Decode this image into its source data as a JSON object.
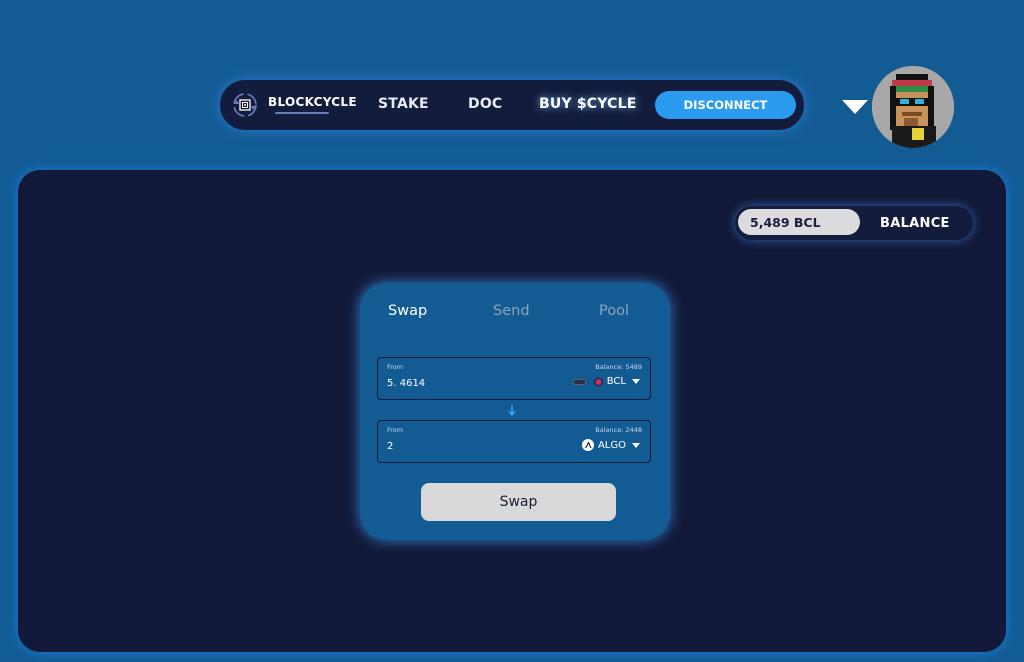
{
  "nav": {
    "logo_text": "BLOCKCYCLE",
    "links": [
      "STAKE",
      "DOC",
      "BUY $CYCLE"
    ],
    "disconnect_label": "DISCONNECT"
  },
  "balance": {
    "amount": "5,489 BCL",
    "label": "BALANCE"
  },
  "swap_card": {
    "tabs": [
      "Swap",
      "Send",
      "Pool"
    ],
    "active_tab": "Swap",
    "from": {
      "label": "From",
      "balance": "Balance: 5489",
      "value": "5. 4614",
      "token": "BCL"
    },
    "to": {
      "label": "From",
      "balance": "Balance: 2448",
      "value": "2",
      "token": "ALGO"
    },
    "swap_button": "Swap"
  },
  "colors": {
    "page_bg": "#135b93",
    "panel_bg": "#131938",
    "accent": "#2b9bf0",
    "glow": "#3c96ff"
  },
  "icons": {
    "logo": "blockcycle-logo-icon",
    "account_menu": "chevron-down-icon",
    "swap_direction": "arrow-down-icon",
    "bcl_token": "bcl-token-icon",
    "algo_token": "algo-token-icon"
  }
}
